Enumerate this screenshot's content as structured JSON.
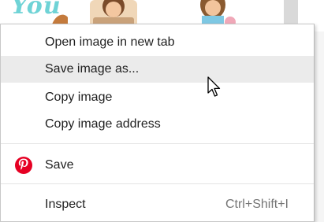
{
  "background": {
    "partial_text": "You"
  },
  "menu": {
    "items": [
      {
        "label": "Open image in new tab"
      },
      {
        "label": "Save image as..."
      },
      {
        "label": "Copy image"
      },
      {
        "label": "Copy image address"
      }
    ],
    "extension_item": {
      "label": "Save",
      "icon": "pinterest-icon",
      "brand_color": "#e60023"
    },
    "inspect": {
      "label": "Inspect",
      "shortcut": "Ctrl+Shift+I"
    }
  }
}
